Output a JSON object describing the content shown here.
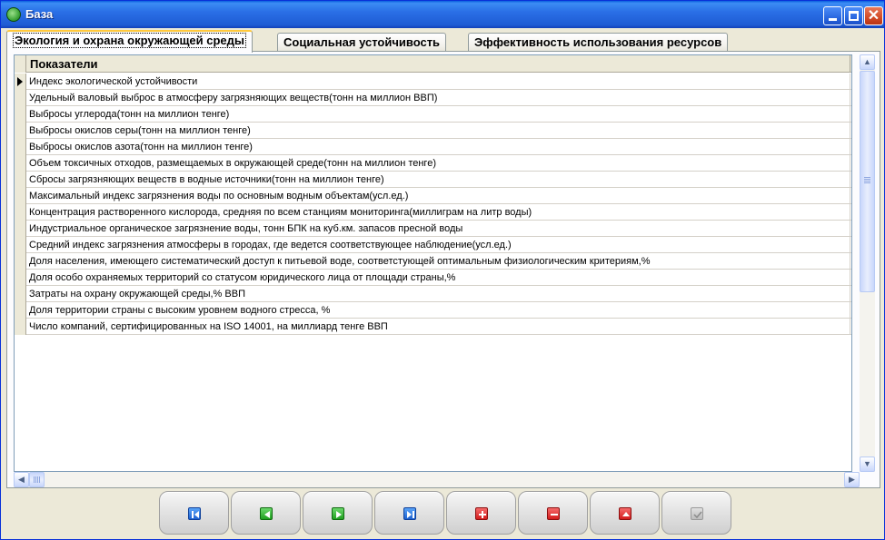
{
  "window": {
    "title": "База",
    "controls": [
      "minimize-icon",
      "maximize-icon",
      "close-icon"
    ],
    "close_glyph": "✕"
  },
  "tabs": [
    {
      "label": "Экология и охрана окружающей среды",
      "active": true
    },
    {
      "label": "Социальная устойчивость",
      "active": false
    },
    {
      "label": "Эффективность использования ресурсов",
      "active": false
    }
  ],
  "grid": {
    "column_header": "Показатели",
    "current_row": 0,
    "rows": [
      "Индекс экологической устойчивости",
      "Удельный валовый выброс в атмосферу загрязняющих веществ(тонн на миллион ВВП)",
      "Выбросы углерода(тонн на миллион тенге)",
      "Выбросы окислов серы(тонн на миллион тенге)",
      "Выбросы окислов азота(тонн на миллион тенге)",
      "Объем токсичных отходов, размещаемых в окружающей среде(тонн на миллион тенге)",
      "Сбросы загрязняющих веществ в водные источники(тонн на миллион тенге)",
      "Максимальный индекс загрязнения воды по основным водным объектам(усл.ед.)",
      "Концентрация растворенного кислорода, средняя по всем станциям мониторинга(миллиграм на литр воды)",
      "Индустриальное органическое загрязнение воды, тонн БПК на куб.км. запасов пресной воды",
      "Средний индекс загрязнения атмосферы в городах, где ведется соответствующее наблюдение(усл.ед.)",
      "Доля населения, имеющего систематический доступ к питьевой воде, соответстующей оптимальным физиологическим критериям,%",
      "Доля особо охраняемых территорий со статусом юридического лица от площади страны,%",
      "Затраты на охрану окружающей среды,% ВВП",
      "Доля территории страны с высоким уровнем водного стресса, %",
      "Число компаний, сертифицированных на ISO 14001, на миллиард тенге ВВП"
    ]
  },
  "navigator": [
    {
      "name": "first-record-button",
      "icon": "first-icon",
      "color": "blue"
    },
    {
      "name": "prior-record-button",
      "icon": "prior-icon",
      "color": "green"
    },
    {
      "name": "next-record-button",
      "icon": "next-icon",
      "color": "green"
    },
    {
      "name": "last-record-button",
      "icon": "last-icon",
      "color": "blue"
    },
    {
      "name": "insert-record-button",
      "icon": "plus-icon",
      "color": "red"
    },
    {
      "name": "delete-record-button",
      "icon": "minus-icon",
      "color": "red"
    },
    {
      "name": "edit-record-button",
      "icon": "edit-icon",
      "color": "red"
    },
    {
      "name": "post-record-button",
      "icon": "check-icon",
      "color": "grey"
    }
  ]
}
